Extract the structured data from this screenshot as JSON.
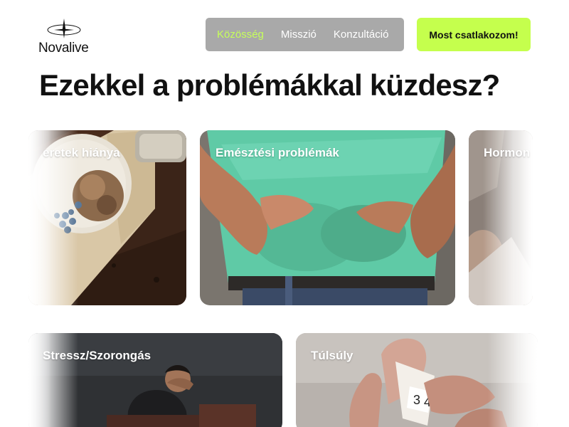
{
  "brand": {
    "name": "Novalive",
    "logo_icon": "compass-star-icon"
  },
  "nav": {
    "items": [
      {
        "label": "Közösség",
        "active": true
      },
      {
        "label": "Misszió",
        "active": false
      },
      {
        "label": "Konzultáció",
        "active": false
      }
    ]
  },
  "cta": {
    "label": "Most csatlakozom!"
  },
  "headline": "Ezekkel a problémákkal küzdesz?",
  "cards": [
    {
      "label": "eretek hiánya"
    },
    {
      "label": "Emésztési problémák"
    },
    {
      "label": "Hormon"
    },
    {
      "label": "Stressz/Szorongás"
    },
    {
      "label": "Túlsúly"
    }
  ],
  "colors": {
    "accent": "#c5ff4d",
    "nav_bg": "#a9a9a9",
    "active_nav": "#c6ff5a"
  }
}
